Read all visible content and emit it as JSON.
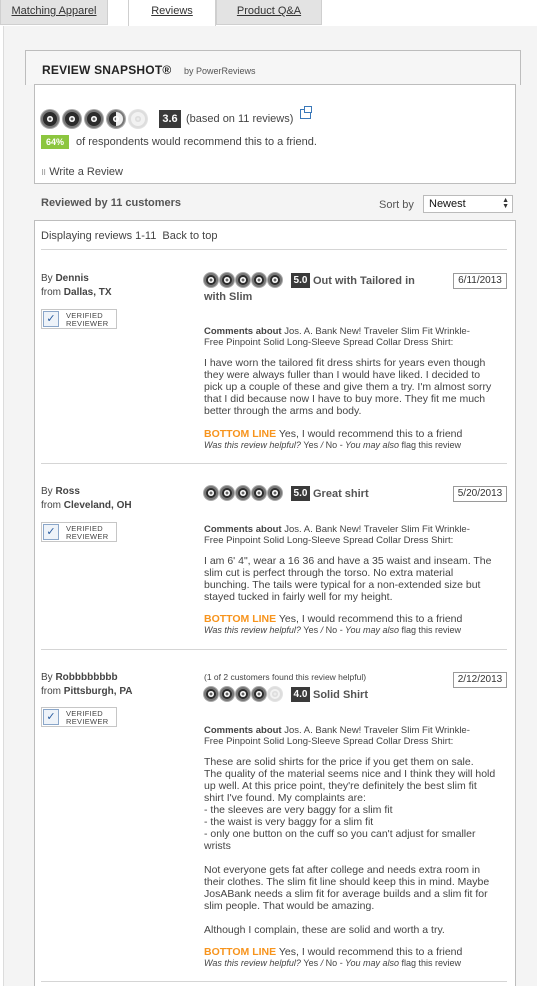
{
  "tabs": [
    "Matching Apparel",
    "Reviews",
    "Product Q&A"
  ],
  "snapshot": {
    "title": "REVIEW SNAPSHOT®",
    "by": "by PowerReviews",
    "rating": "3.6",
    "based_on": "(based on 11 reviews)",
    "recommend_pct": "64%",
    "recommend_text": "of respondents would recommend this to a friend.",
    "write_review": "Write a Review"
  },
  "reviews_header": {
    "reviewed_by": "Reviewed by 11 customers",
    "sort_label": "Sort by",
    "sort_value": "Newest",
    "displaying": "Displaying reviews 1-11",
    "back_to_top": "Back to top"
  },
  "verified": [
    "VERIFIED",
    "REVIEWER"
  ],
  "reviews": [
    {
      "by_label": "By",
      "name": "Dennis",
      "from_label": "from",
      "location": "Dallas, TX",
      "helpful_count": "",
      "rating": "5.0",
      "stars": 5,
      "title_line1": "Out with Tailored in",
      "title_line2": "with Slim",
      "date": "6/11/2013",
      "comments_label": "Comments about",
      "product_line1": "Jos. A. Bank New! Traveler Slim Fit Wrinkle-",
      "product_line2": "Free Pinpoint Solid Long-Sleeve Spread Collar Dress Shirt:",
      "body": [
        "I have worn the tailored fit dress shirts for years even though",
        "they were always fuller than I would have liked. I decided to",
        "pick up a couple of these and give them a try. I'm almost sorry",
        "that I did because now I have to buy more. They fit me much",
        "better through the arms and body."
      ],
      "bottom_line_label": "BOTTOM LINE",
      "bottom_line": "Yes, I would recommend this to a friend",
      "helpful_q": "Was this review helpful?",
      "yes": "Yes",
      "no": "No",
      "also": "- You may also",
      "flag": "flag this review"
    },
    {
      "by_label": "By",
      "name": "Ross",
      "from_label": "from",
      "location": "Cleveland, OH",
      "helpful_count": "",
      "rating": "5.0",
      "stars": 5,
      "title_line1": "Great shirt",
      "title_line2": "",
      "date": "5/20/2013",
      "comments_label": "Comments about",
      "product_line1": "Jos. A. Bank New! Traveler Slim Fit Wrinkle-",
      "product_line2": "Free Pinpoint Solid Long-Sleeve Spread Collar Dress Shirt:",
      "body": [
        "I am 6' 4\", wear a 16 36 and have a 35 waist and inseam. The",
        "slim cut is perfect through the torso. No extra material",
        "bunching. The tails were typical for a non-extended size but",
        "stayed tucked in fairly well for my height."
      ],
      "bottom_line_label": "BOTTOM LINE",
      "bottom_line": "Yes, I would recommend this to a friend",
      "helpful_q": "Was this review helpful?",
      "yes": "Yes",
      "no": "No",
      "also": "- You may also",
      "flag": "flag this review"
    },
    {
      "by_label": "By",
      "name": "Robbbbbbbb",
      "from_label": "from",
      "location": "Pittsburgh, PA",
      "helpful_count": "(1 of 2 customers found this review helpful)",
      "rating": "4.0",
      "stars": 4,
      "title_line1": "Solid Shirt",
      "title_line2": "",
      "date": "2/12/2013",
      "comments_label": "Comments about",
      "product_line1": "Jos. A. Bank New! Traveler Slim Fit Wrinkle-",
      "product_line2": "Free Pinpoint Solid Long-Sleeve Spread Collar Dress Shirt:",
      "body": [
        "These are solid shirts for the price if you get them on sale.",
        "The quality of the material seems nice and I think they will hold",
        "up well. At this price point, they're definitely the best slim fit",
        "shirt I've found. My complaints are:",
        "- the sleeves are very baggy for a slim fit",
        "- the waist is very baggy for a slim fit",
        "- only one button on the cuff so you can't adjust for smaller",
        "wrists",
        "",
        "Not everyone gets fat after college and needs extra room in",
        "their clothes. The slim fit line should keep this in mind. Maybe",
        "JosABank needs a slim fit for average builds and a slim fit for",
        "slim people. That would be amazing.",
        "",
        "Although I complain, these are solid and worth a try."
      ],
      "bottom_line_label": "BOTTOM LINE",
      "bottom_line": "Yes, I would recommend this to a friend",
      "helpful_q": "Was this review helpful?",
      "yes": "Yes",
      "no": "No",
      "also": "- You may also",
      "flag": "flag this review"
    }
  ]
}
